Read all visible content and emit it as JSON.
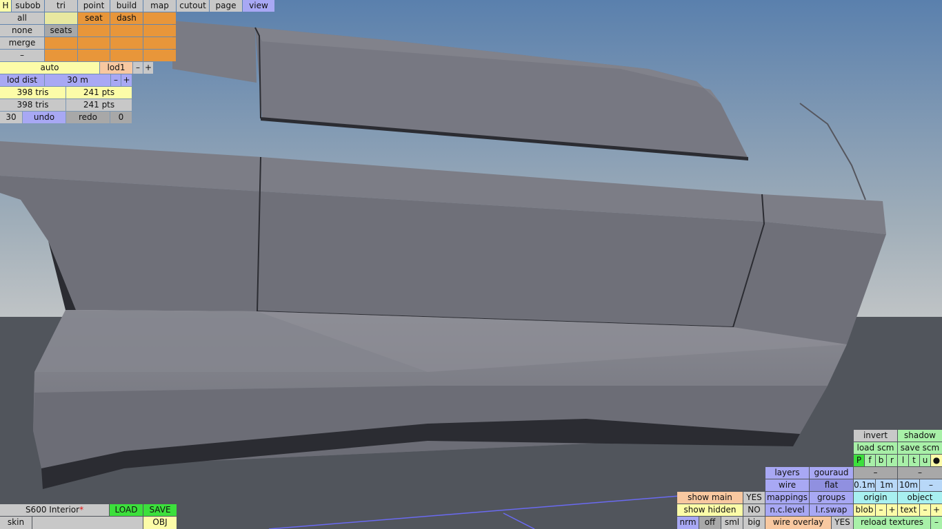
{
  "top_menu": {
    "h": "H",
    "tabs": [
      "subob",
      "tri",
      "point",
      "build",
      "map",
      "cutout",
      "page",
      "view"
    ]
  },
  "selection": {
    "all": "all",
    "none": "none",
    "merge": "merge",
    "dash_btn": "–",
    "seat": "seat",
    "dash": "dash",
    "seats": "seats"
  },
  "lod": {
    "auto": "auto",
    "level": "lod1",
    "minus": "–",
    "plus": "+",
    "dist_label": "lod dist",
    "dist_value": "30 m"
  },
  "stats": {
    "tris1": "398 tris",
    "pts1": "241 pts",
    "tris2": "398 tris",
    "pts2": "241 pts"
  },
  "history": {
    "count": "30",
    "undo": "undo",
    "redo": "redo",
    "zero": "0"
  },
  "file": {
    "name": "S600 Interior",
    "modified_mark": "*",
    "load": "LOAD",
    "save": "SAVE",
    "skin": "skin",
    "obj": "OBJ"
  },
  "display": {
    "invert": "invert",
    "shadow": "shadow",
    "load_scm": "load scm",
    "save_scm": "save scm",
    "letters": [
      "P",
      "f",
      "b",
      "r",
      "l",
      "t",
      "u",
      "●"
    ],
    "dash": "–",
    "layers": "layers",
    "gouraud": "gouraud",
    "wire": "wire",
    "flat": "flat",
    "d01": "0.1m",
    "d1": "1m",
    "d10": "10m",
    "mappings": "mappings",
    "groups": "groups",
    "origin": "origin",
    "object": "object",
    "nclevel": "n.c.level",
    "lrswap": "l.r.swap",
    "blob": "blob",
    "text": "text",
    "minus": "–",
    "plus": "+",
    "show_main": "show main",
    "show_main_val": "YES",
    "show_hidden": "show hidden",
    "show_hidden_val": "NO",
    "nrm": "nrm",
    "off": "off",
    "sml": "sml",
    "big": "big",
    "wire_overlay": "wire overlay",
    "wire_overlay_val": "YES",
    "reload_textures": "reload textures"
  },
  "colors": {
    "sky_top": "#5a80ad",
    "sky_bottom": "#bcc2c6",
    "ground": "#51555c",
    "model_face": "#75767f",
    "model_dark": "#2b2c32",
    "selection_line": "#6a6af2"
  }
}
